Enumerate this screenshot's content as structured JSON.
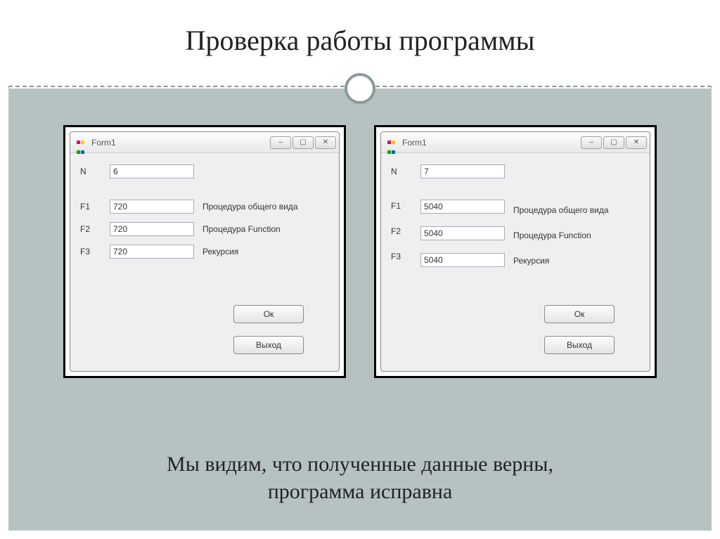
{
  "slide": {
    "title": "Проверка работы программы",
    "caption_line1": "Мы видим, что полученные данные верны,",
    "caption_line2": "программа исправна"
  },
  "window_common": {
    "title": "Form1",
    "btn_ok": "Ок",
    "btn_exit": "Выход",
    "label_n": "N",
    "label_f1": "F1",
    "label_f2": "F2",
    "label_f3": "F3",
    "desc_f1": "Процедура общего вида",
    "desc_f2": "Процедура Function",
    "desc_f3": "Рекурсия",
    "min_glyph": "–",
    "max_glyph": "▢",
    "close_glyph": "✕"
  },
  "win1": {
    "n": "6",
    "f1": "720",
    "f2": "720",
    "f3": "720"
  },
  "win2": {
    "n": "7",
    "f1": "5040",
    "f2": "5040",
    "f3": "5040"
  }
}
